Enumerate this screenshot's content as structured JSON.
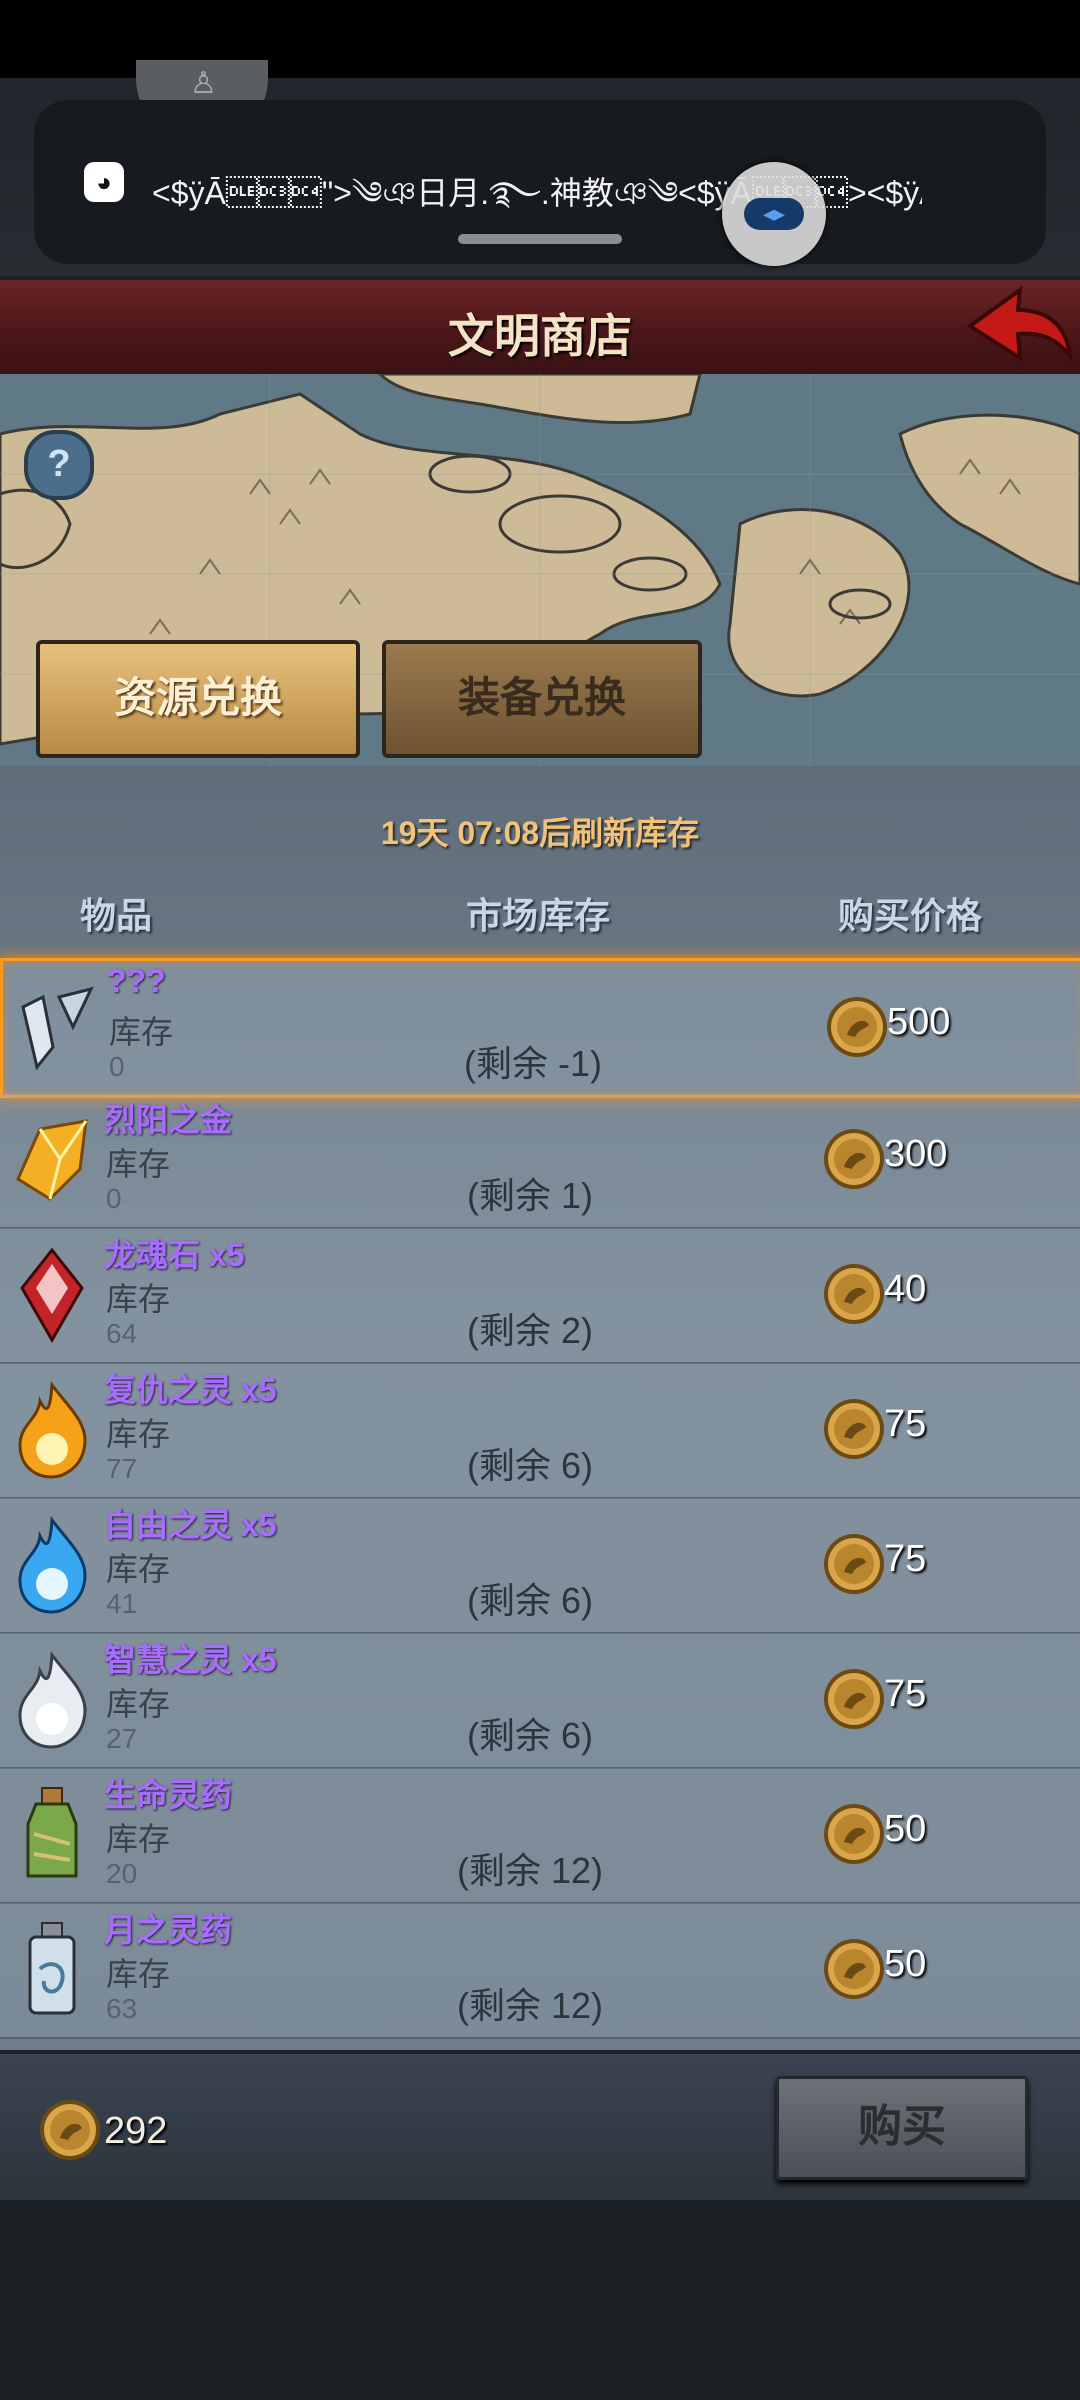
{
  "notification": {
    "app_icon": "qq-penguin-icon",
    "text": "<$ÿĀ\u0010\u0013\u0014\">༄ঞ日月.࿐.神教ঞ༄<$ÿĀ\u0010\u0013\u0014><$ÿĀ\u0010\u0013\u0014>··"
  },
  "header": {
    "title": "文明商店"
  },
  "tabs": [
    {
      "label": "资源兑换",
      "active": true
    },
    {
      "label": "装备兑换",
      "active": false
    }
  ],
  "refresh_notice": {
    "days": "19天",
    "time": "07:08",
    "suffix": "后刷新库存"
  },
  "columns": {
    "item": "物品",
    "market_stock": "市场库存",
    "price": "购买价格"
  },
  "stock_label": "库存",
  "items": [
    {
      "name": "???",
      "owned": "0",
      "remaining": "(剩余 -1)",
      "price": "500",
      "icon": "crystal-shards-icon",
      "selected": true
    },
    {
      "name": "烈阳之金",
      "owned": "0",
      "remaining": "(剩余 1)",
      "price": "300",
      "icon": "sun-gold-icon"
    },
    {
      "name": "龙魂石 x5",
      "owned": "64",
      "remaining": "(剩余 2)",
      "price": "40",
      "icon": "dragon-soul-stone-icon"
    },
    {
      "name": "复仇之灵 x5",
      "owned": "77",
      "remaining": "(剩余 6)",
      "price": "75",
      "icon": "fire-spirit-icon"
    },
    {
      "name": "自由之灵 x5",
      "owned": "41",
      "remaining": "(剩余 6)",
      "price": "75",
      "icon": "blue-spirit-icon"
    },
    {
      "name": "智慧之灵 x5",
      "owned": "27",
      "remaining": "(剩余 6)",
      "price": "75",
      "icon": "white-spirit-icon"
    },
    {
      "name": "生命灵药",
      "owned": "20",
      "remaining": "(剩余 12)",
      "price": "50",
      "icon": "life-elixir-icon"
    },
    {
      "name": "月之灵药",
      "owned": "63",
      "remaining": "(剩余 12)",
      "price": "50",
      "icon": "moon-elixir-icon"
    }
  ],
  "footer": {
    "gold": "292",
    "buy_label": "购买"
  },
  "colors": {
    "accent_orange": "#ff9a1c",
    "item_purple": "#a86cff",
    "gold": "#d9a64a",
    "header_red": "#5a1c1e"
  }
}
